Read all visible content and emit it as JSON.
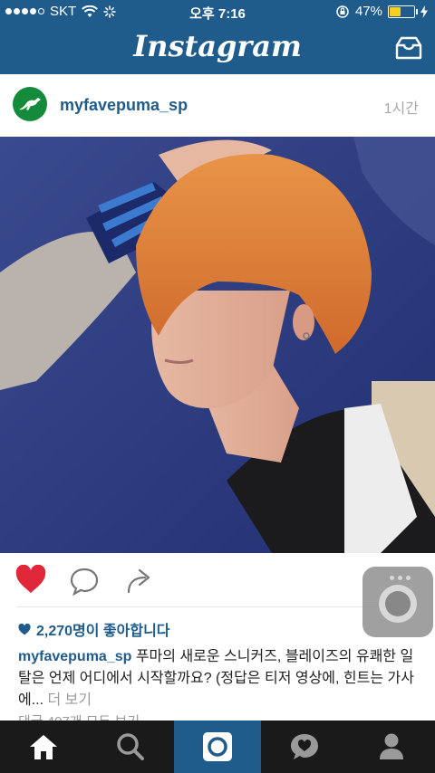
{
  "status": {
    "carrier": "SKT",
    "time": "오후 7:16",
    "battery": "47%",
    "battery_level": 0.47
  },
  "nav": {
    "logo": "Instagram"
  },
  "post": {
    "username": "myfavepuma_sp",
    "time_ago": "1시간",
    "likes": "2,270명이 좋아합니다",
    "caption_user": "myfavepuma_sp",
    "caption_text": " 푸마의 새로운 스니커즈, 블레이즈의 유쾌한 일탈은 언제 어디에서 시작할까요? (정답은 티저 영상에, 힌트는 가사에...",
    "more": " 더 보기",
    "comments": "댓글 407개 모두 보기"
  },
  "icons": {
    "heart": "heart-icon",
    "comment": "comment-icon",
    "share": "share-icon",
    "home": "home-icon",
    "search": "search-icon",
    "camera": "camera-icon",
    "activity": "activity-icon",
    "profile": "profile-icon"
  },
  "colors": {
    "brand": "#1f5c8c",
    "like": "#e0283a",
    "puma": "#138b3a"
  }
}
